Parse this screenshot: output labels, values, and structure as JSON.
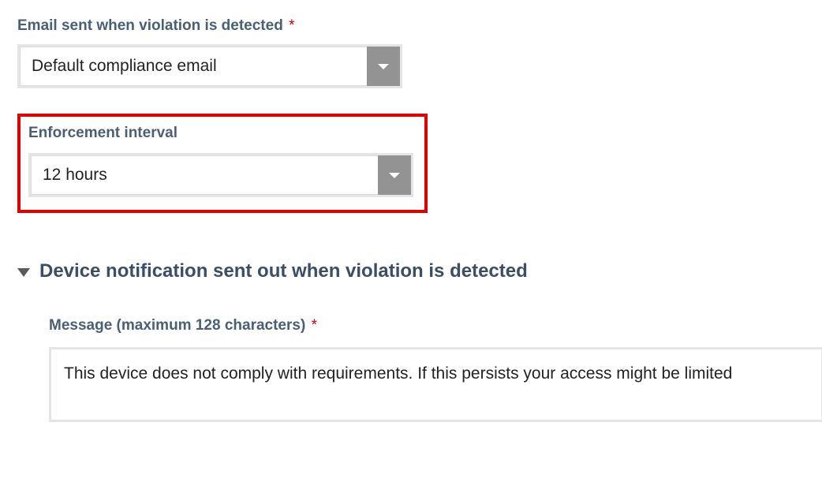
{
  "email_field": {
    "label": "Email sent when violation is detected",
    "required_mark": "*",
    "value": "Default compliance email"
  },
  "enforcement_field": {
    "label": "Enforcement interval",
    "value": "12 hours"
  },
  "notification_section": {
    "title": "Device notification sent out when violation is detected",
    "message_label": "Message (maximum 128 characters)",
    "required_mark": "*",
    "message_value": "This device does not comply with requirements. If this persists your access might be limited"
  }
}
